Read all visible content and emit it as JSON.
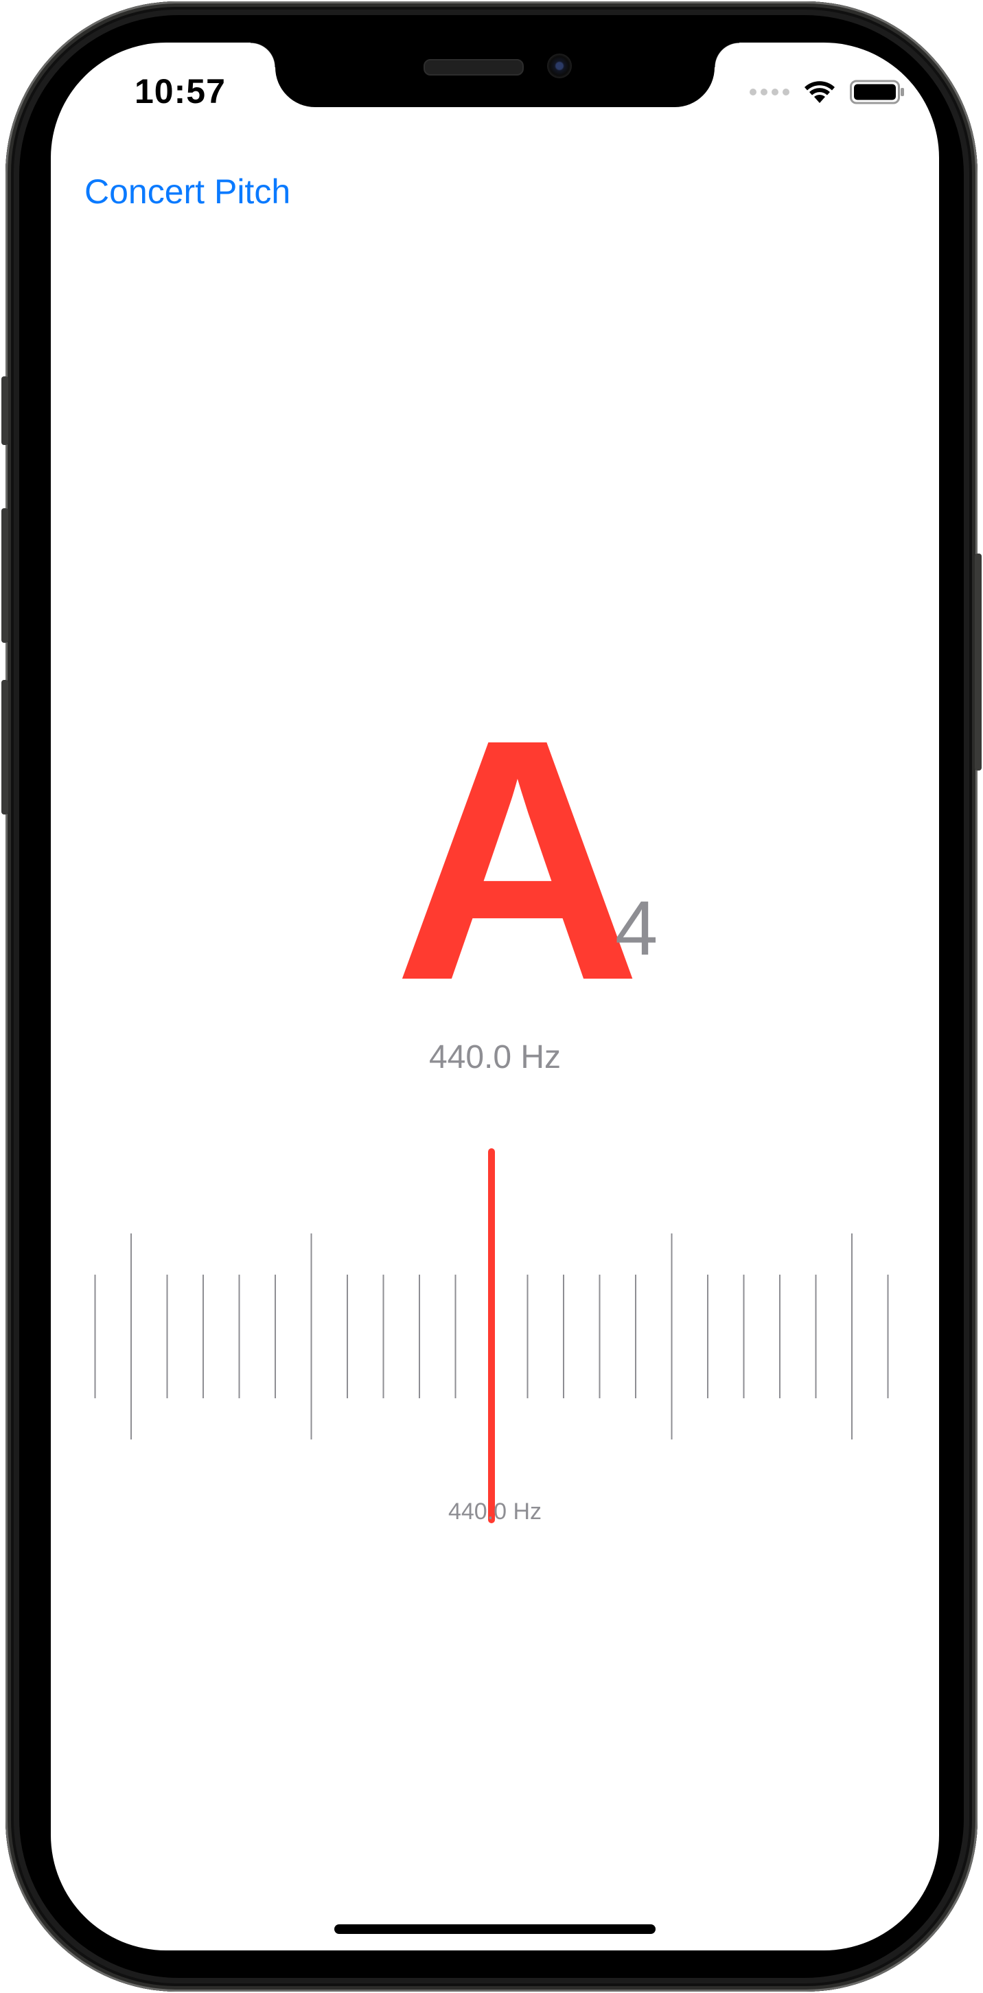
{
  "status_bar": {
    "time": "10:57",
    "icons": [
      "cellular-signal-icon",
      "wifi-icon",
      "battery-icon"
    ]
  },
  "nav": {
    "concert_pitch_label": "Concert Pitch"
  },
  "tuner": {
    "note": "A",
    "octave": "4",
    "detected_frequency": "440.0 Hz",
    "needle_frequency": "440.0 Hz",
    "cents_offset": 0
  },
  "colors": {
    "accent_blue": "#0a7aff",
    "note_red": "#ff3b30",
    "secondary_gray": "#8e8e93",
    "tick_gray": "#8e8e93"
  }
}
